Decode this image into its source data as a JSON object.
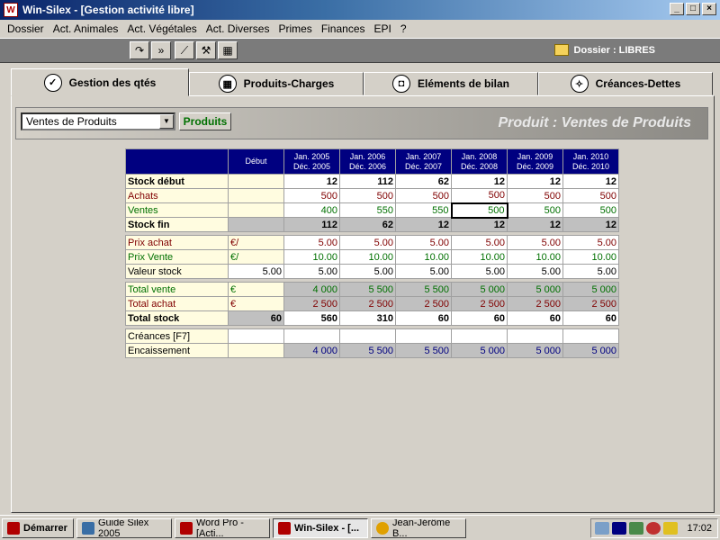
{
  "window": {
    "title": "Win-Silex - [Gestion activité libre]",
    "controls": [
      "_",
      "□",
      "×"
    ]
  },
  "menu": [
    "Dossier",
    "Act. Animales",
    "Act. Végétales",
    "Act. Diverses",
    "Primes",
    "Finances",
    "EPI",
    "?"
  ],
  "toolbar": {
    "buttons": [
      "redo",
      "fast-forward",
      "chart",
      "tools",
      "calculator"
    ],
    "dossier_label": "Dossier : LIBRES"
  },
  "tabs": [
    {
      "label": "Gestion des qtés",
      "icon": "check-icon"
    },
    {
      "label": "Produits-Charges",
      "icon": "calculator-icon"
    },
    {
      "label": "Eléments de bilan",
      "icon": "wallet-icon"
    },
    {
      "label": "Créances-Dettes",
      "icon": "compass-icon"
    }
  ],
  "subheader": {
    "product_select": "Ventes de Produits",
    "produits_button": "Produits",
    "title": "Produit : Ventes de Produits"
  },
  "table": {
    "debut_label": "Début",
    "periods": [
      [
        "Jan. 2005",
        "Déc. 2005"
      ],
      [
        "Jan. 2006",
        "Déc. 2006"
      ],
      [
        "Jan. 2007",
        "Déc. 2007"
      ],
      [
        "Jan. 2008",
        "Déc. 2008"
      ],
      [
        "Jan. 2009",
        "Déc. 2009"
      ],
      [
        "Jan. 2010",
        "Déc. 2010"
      ]
    ],
    "stock_debut": {
      "label": "Stock début",
      "values": [
        "12",
        "112",
        "62",
        "12",
        "12",
        "12"
      ]
    },
    "achats": {
      "label": "Achats",
      "values": [
        "500",
        "500",
        "500",
        "500",
        "500",
        "500"
      ]
    },
    "ventes": {
      "label": "Ventes",
      "values": [
        "400",
        "550",
        "550",
        "500",
        "500",
        "500"
      ]
    },
    "stock_fin": {
      "label": "Stock fin",
      "values": [
        "112",
        "62",
        "12",
        "12",
        "12",
        "12"
      ]
    },
    "prix_achat": {
      "label": "Prix achat",
      "unit": "€/",
      "values": [
        "5.00",
        "5.00",
        "5.00",
        "5.00",
        "5.00",
        "5.00"
      ]
    },
    "prix_vente": {
      "label": "Prix Vente",
      "unit": "€/",
      "values": [
        "10.00",
        "10.00",
        "10.00",
        "10.00",
        "10.00",
        "10.00"
      ]
    },
    "valeur_stock": {
      "label": "Valeur stock",
      "debut": "5.00",
      "values": [
        "5.00",
        "5.00",
        "5.00",
        "5.00",
        "5.00",
        "5.00"
      ]
    },
    "total_vente": {
      "label": "Total vente",
      "unit": "€",
      "values": [
        "4 000",
        "5 500",
        "5 500",
        "5 000",
        "5 000",
        "5 000"
      ]
    },
    "total_achat": {
      "label": "Total achat",
      "unit": "€",
      "values": [
        "2 500",
        "2 500",
        "2 500",
        "2 500",
        "2 500",
        "2 500"
      ]
    },
    "total_stock": {
      "label": "Total stock",
      "debut": "60",
      "values": [
        "560",
        "310",
        "60",
        "60",
        "60",
        "60"
      ]
    },
    "creances": {
      "label": "Créances [F7]"
    },
    "encaissement": {
      "label": "Encaissement",
      "values": [
        "4 000",
        "5 500",
        "5 500",
        "5 000",
        "5 000",
        "5 000"
      ]
    }
  },
  "taskbar": {
    "start": "Démarrer",
    "tasks": [
      "Guide Silex 2005",
      "Word Pro - [Acti...",
      "Win-Silex - [...",
      "Jean-Jérôme B..."
    ],
    "clock": "17:02"
  }
}
